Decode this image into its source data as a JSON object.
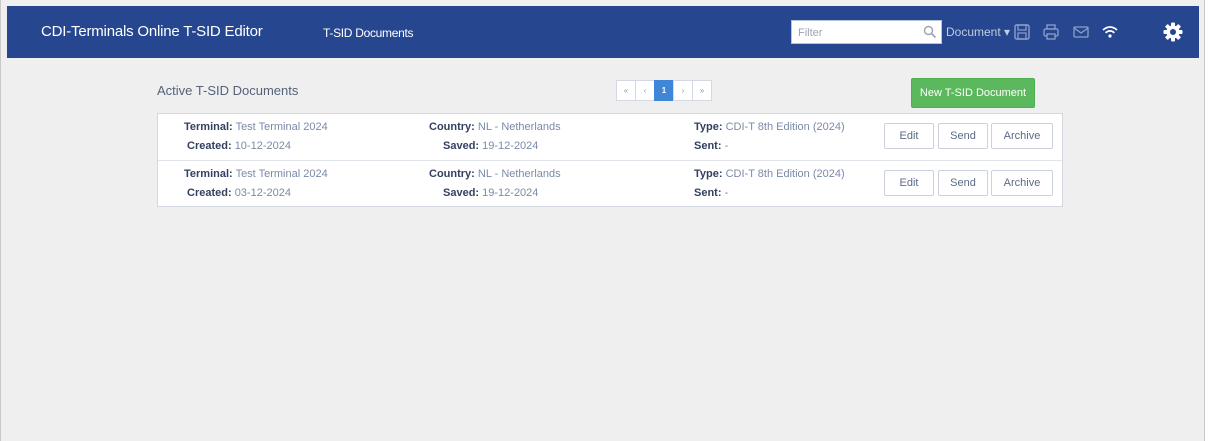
{
  "app": {
    "title": "CDI-Terminals Online T-SID Editor",
    "nav_link": "T-SID Documents",
    "filter_placeholder": "Filter",
    "document_menu": "Document ▾",
    "brand_color": "#26478f"
  },
  "toolbar_icons": [
    "save-icon",
    "print-icon",
    "email-icon",
    "wifi-icon",
    "gear-icon"
  ],
  "main": {
    "heading": "Active T-SID Documents",
    "pagination": {
      "first": "«",
      "prev": "‹",
      "current": "1",
      "next": "›",
      "last": "»"
    },
    "new_button": "New T-SID Document",
    "field_labels": {
      "terminal": "Terminal:",
      "created": "Created:",
      "country": "Country:",
      "saved": "Saved:",
      "type": "Type:",
      "sent": "Sent:"
    },
    "row_actions": {
      "edit": "Edit",
      "send": "Send",
      "archive": "Archive"
    },
    "documents": [
      {
        "terminal": "Test Terminal 2024",
        "created": "10-12-2024",
        "country": "NL - Netherlands",
        "saved": "19-12-2024",
        "type": "CDI-T 8th Edition (2024)",
        "sent": "-"
      },
      {
        "terminal": "Test Terminal 2024",
        "created": "03-12-2024",
        "country": "NL - Netherlands",
        "saved": "19-12-2024",
        "type": "CDI-T 8th Edition (2024)",
        "sent": "-"
      }
    ]
  }
}
